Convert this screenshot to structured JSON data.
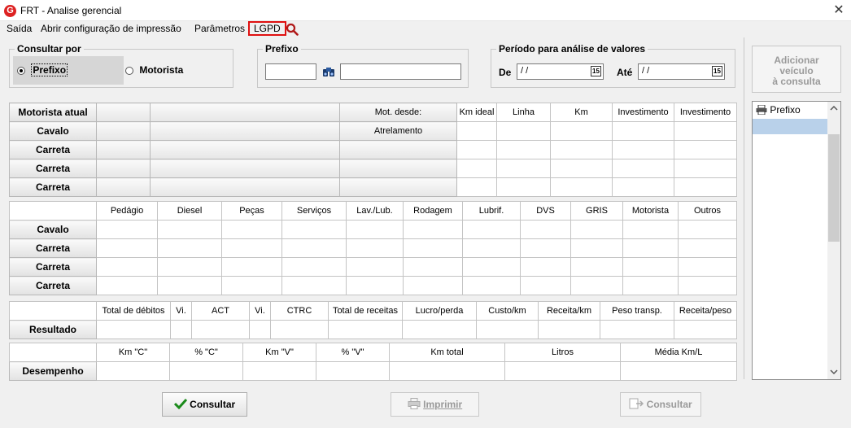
{
  "window": {
    "title": "FRT - Analise gerencial",
    "app_icon": "G",
    "close_glyph": "✕"
  },
  "menu": [
    {
      "label": "Saída"
    },
    {
      "label": "Abrir configuração de impressão"
    },
    {
      "label": "Parâmetros"
    },
    {
      "label": "LGPD"
    }
  ],
  "consultar_por": {
    "title": "Consultar por",
    "options": [
      {
        "label": "Prefixo",
        "selected": true
      },
      {
        "label": "Motorista",
        "selected": false
      }
    ]
  },
  "prefixo": {
    "title": "Prefixo",
    "code": "",
    "name": ""
  },
  "periodo": {
    "title": "Período para análise de valores",
    "de_label": "De",
    "de_value": "/ /",
    "ate_label": "Até",
    "ate_value": "/ /",
    "cal_glyph": "15"
  },
  "add_button": {
    "line1": "Adicionar",
    "line2": "veículo",
    "line3": "à consulta"
  },
  "table1": {
    "header": [
      "Motorista atual",
      "",
      "",
      "Mot. desde:",
      "Km ideal",
      "Linha",
      "Km",
      "Investimento",
      "Investimento"
    ],
    "rows": [
      {
        "label": "Cavalo",
        "mid": "Atrelamento"
      },
      {
        "label": "Carreta",
        "mid": ""
      },
      {
        "label": "Carreta",
        "mid": ""
      },
      {
        "label": "Carreta",
        "mid": ""
      }
    ]
  },
  "table2": {
    "header": [
      "",
      "Pedágio",
      "Diesel",
      "Peças",
      "Serviços",
      "Lav./Lub.",
      "Rodagem",
      "Lubrif.",
      "DVS",
      "GRIS",
      "Motorista",
      "Outros"
    ],
    "rows": [
      "Cavalo",
      "Carreta",
      "Carreta",
      "Carreta"
    ]
  },
  "table3": {
    "header": [
      "",
      "Total de débitos",
      "Vi.",
      "ACT",
      "Vi.",
      "CTRC",
      "Total de receitas",
      "Lucro/perda",
      "Custo/km",
      "Receita/km",
      "Peso transp.",
      "Receita/peso"
    ],
    "rows": [
      "Resultado"
    ]
  },
  "table4": {
    "header": [
      "",
      "Km \"C\"",
      "% \"C\"",
      "Km \"V\"",
      "% \"V\"",
      "Km total",
      "Litros",
      "Média Km/L"
    ],
    "rows": [
      "Desempenho"
    ]
  },
  "side_list": {
    "header": "Prefixo",
    "items": [
      ""
    ]
  },
  "buttons": {
    "consultar": "Consultar",
    "imprimir": "Imprimir",
    "consultar2": "Consultar"
  },
  "colors": {
    "accent_red": "#e01010",
    "selection": "#b9d1ea",
    "ok_green": "#1a8a1a"
  }
}
